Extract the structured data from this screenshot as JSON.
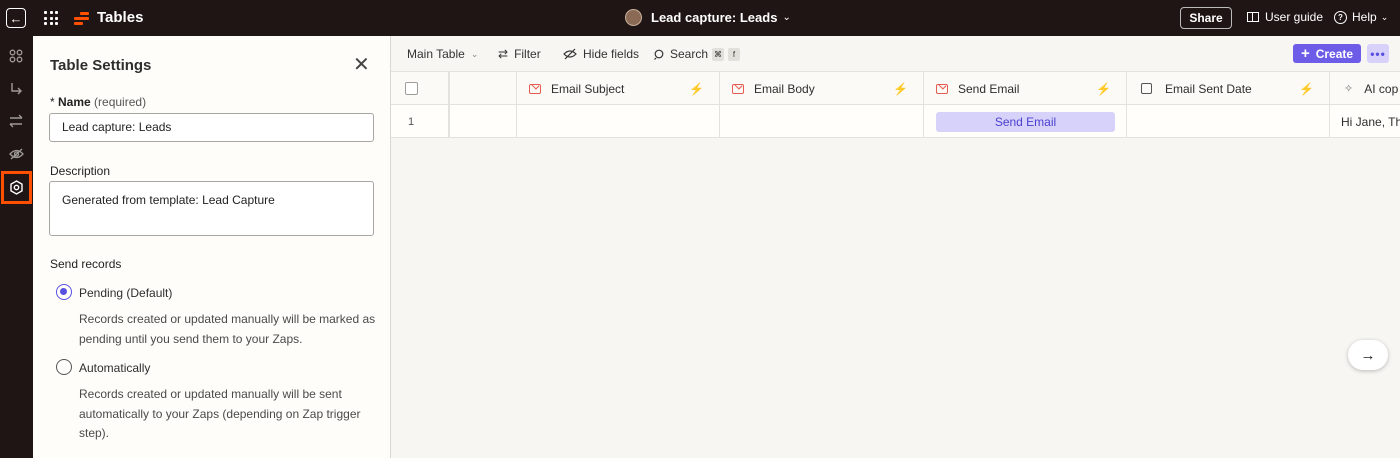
{
  "app": {
    "name": "Tables"
  },
  "header": {
    "title": "Lead capture: Leads",
    "share_label": "Share",
    "user_guide_label": "User guide",
    "help_label": "Help"
  },
  "settings": {
    "title": "Table Settings",
    "name_label": "Name",
    "name_required": "(required)",
    "name_value": "Lead capture: Leads",
    "description_label": "Description",
    "description_value": "Generated from template: Lead Capture",
    "send_records_label": "Send records",
    "options": [
      {
        "label": "Pending (Default)",
        "selected": true,
        "description": "Records created or updated manually will be marked as pending until you send them to your Zaps."
      },
      {
        "label": "Automatically",
        "selected": false,
        "description": "Records created or updated manually will be sent automatically to your Zaps (depending on Zap trigger step)."
      }
    ]
  },
  "toolbar": {
    "view_label": "Main Table",
    "filter_label": "Filter",
    "hide_fields_label": "Hide fields",
    "search_label": "Search",
    "search_shortcut_1": "⌘",
    "search_shortcut_2": "f",
    "create_label": "Create"
  },
  "table": {
    "columns": [
      {
        "name": "Email Subject",
        "icon": "mail-icon"
      },
      {
        "name": "Email Body",
        "icon": "mail-icon"
      },
      {
        "name": "Send Email",
        "icon": "mail-icon"
      },
      {
        "name": "Email Sent Date",
        "icon": "calendar-icon"
      },
      {
        "name": "AI cop",
        "icon": "ai-icon"
      }
    ],
    "rows": [
      {
        "num": "1",
        "send_button": "Send Email",
        "ai_cell": "Hi Jane, Th"
      }
    ]
  },
  "colors": {
    "accent": "#6d5ce8",
    "brand": "#ff4f00",
    "topbar": "#201515"
  }
}
